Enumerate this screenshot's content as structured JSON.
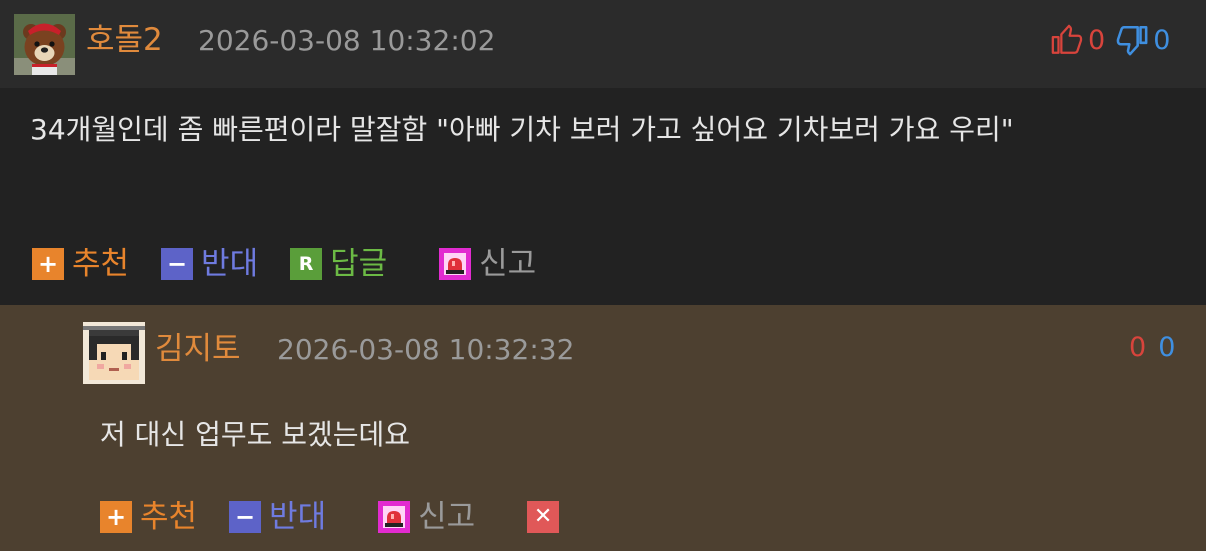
{
  "comments": [
    {
      "username": "호돌2",
      "timestamp": "2026-03-08 10:32:02",
      "upvotes": "0",
      "downvotes": "0",
      "body": "34개월인데 좀 빠른편이라 말잘함 \"아빠 기차 보러 가고 싶어요 기차보러 가요 우리\"",
      "actions": {
        "recommend": "추천",
        "oppose": "반대",
        "reply": "답글",
        "reply_icon": "R",
        "report": "신고"
      }
    },
    {
      "username": "김지토",
      "timestamp": "2026-03-08 10:32:32",
      "upvotes": "0",
      "downvotes": "0",
      "body": "저 대신 업무도 보겠는데요",
      "actions": {
        "recommend": "추천",
        "oppose": "반대",
        "report": "신고"
      }
    }
  ],
  "icons": {
    "plus": "+",
    "minus": "−",
    "delete": "✕",
    "thumbs_up": "thumbs-up-outline",
    "thumbs_down": "thumbs-down-filled",
    "report": "siren"
  },
  "colors": {
    "username": "#e08a3c",
    "upvote": "#d8443c",
    "downvote": "#3f8fe0",
    "recommend": "#e8842c",
    "oppose": "#5d63c8",
    "reply": "#5a9e3a",
    "report": "#e22bd0",
    "reply_background": "#4d4030"
  }
}
